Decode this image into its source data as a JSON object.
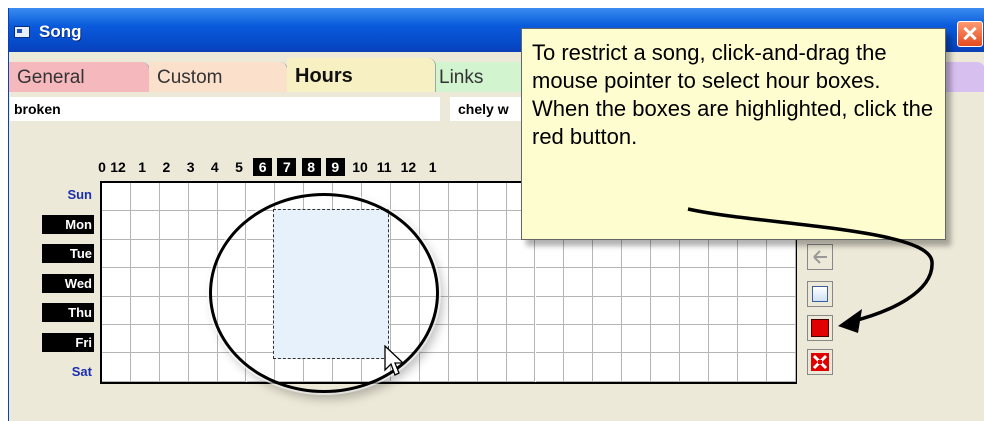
{
  "window": {
    "title": "Song"
  },
  "tabs": [
    {
      "label": "General"
    },
    {
      "label": "Custom"
    },
    {
      "label": "Hours"
    },
    {
      "label": "Links"
    },
    {
      "label": ""
    }
  ],
  "fields": {
    "song_title": "broken",
    "artist_truncated": "chely w"
  },
  "hours": {
    "labels": [
      "0",
      "12",
      "1",
      "2",
      "3",
      "4",
      "5",
      "6",
      "7",
      "8",
      "9",
      "10",
      "11",
      "12",
      "1"
    ],
    "highlighted": [
      "6",
      "7",
      "8",
      "9"
    ]
  },
  "days": [
    {
      "label": "Sun",
      "highlighted": false
    },
    {
      "label": "Mon",
      "highlighted": true
    },
    {
      "label": "Tue",
      "highlighted": true
    },
    {
      "label": "Wed",
      "highlighted": true
    },
    {
      "label": "Thu",
      "highlighted": true
    },
    {
      "label": "Fri",
      "highlighted": true
    },
    {
      "label": "Sat",
      "highlighted": false
    }
  ],
  "side_buttons": [
    {
      "icon": "undo-icon"
    },
    {
      "icon": "clear-selection-icon"
    },
    {
      "icon": "restrict-red-icon"
    },
    {
      "icon": "clear-all-icon"
    }
  ],
  "callout": {
    "text": "To restrict a song, click-and-drag the mouse pointer to select hour boxes.  When the boxes are highlighted, click the red button."
  },
  "colors": {
    "title_bar": "#0a5bdc",
    "tab_general": "#f5b8bd",
    "tab_custom": "#fbe0cc",
    "tab_hours": "#f7f0c2",
    "tab_links": "#d2f5cf",
    "highlight": "#000000",
    "red_button": "#e00000",
    "callout_bg": "#fdfdcf"
  }
}
